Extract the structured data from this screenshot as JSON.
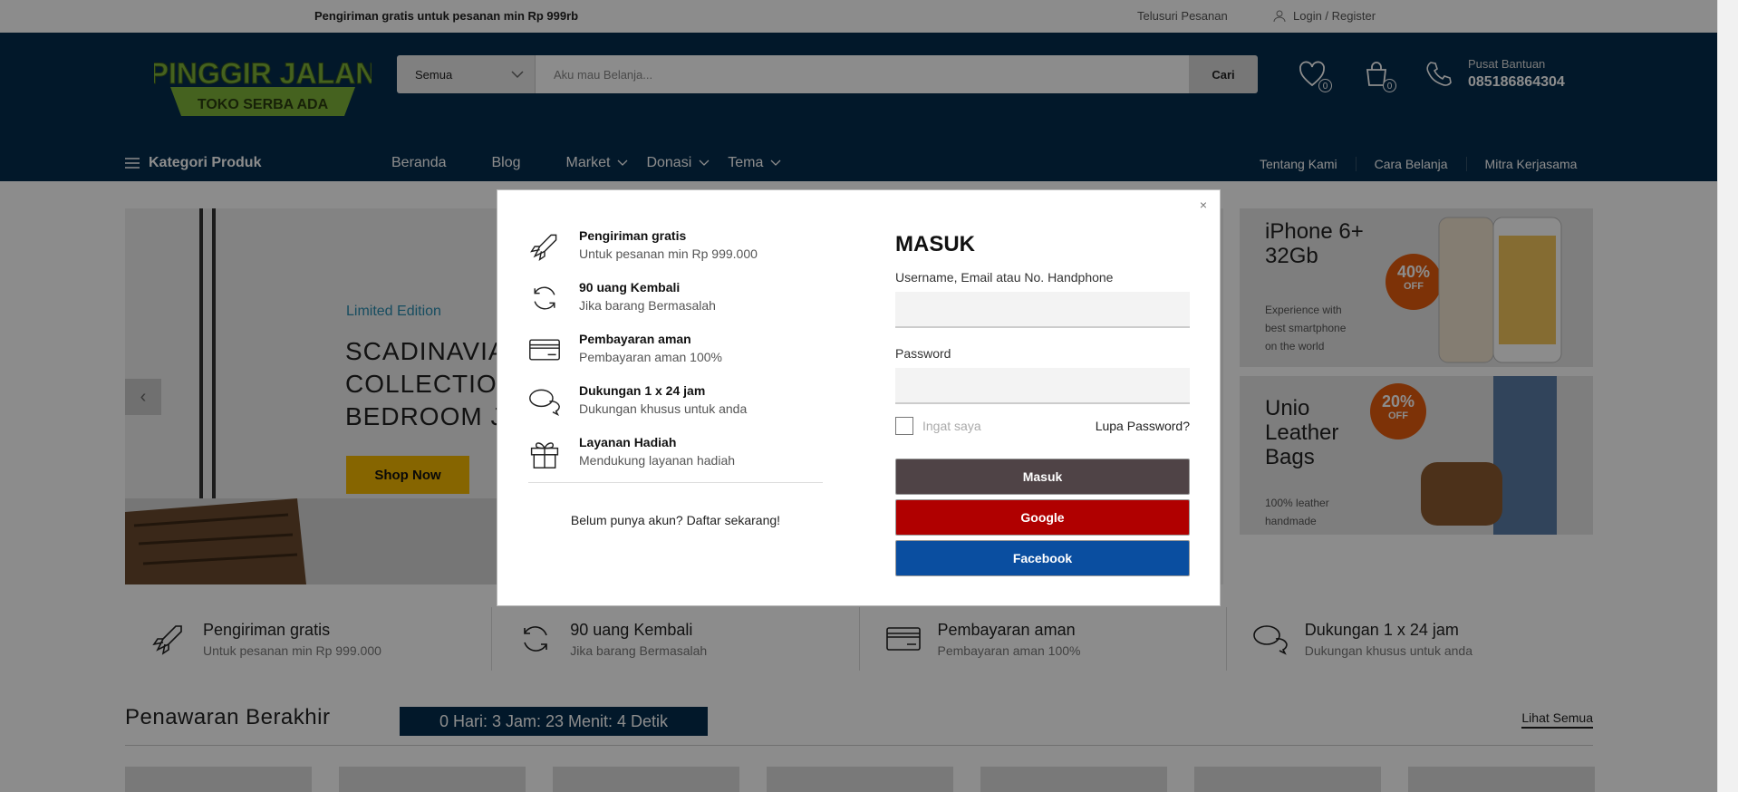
{
  "topbar": {
    "shipping": "Pengiriman gratis untuk pesanan min Rp 999rb",
    "track": "Telusuri Pesanan",
    "login": "Login / Register"
  },
  "header": {
    "logo_line1": "PINGGIR JALAN",
    "logo_line2": "TOKO SERBA ADA",
    "search": {
      "category": "Semua",
      "placeholder": "Aku mau Belanja...",
      "button": "Cari"
    },
    "wishlist_count": "0",
    "cart_count": "0",
    "help_label": "Pusat Bantuan",
    "help_phone": "085186864304"
  },
  "nav": {
    "category_label": "Kategori Produk",
    "items": [
      "Beranda",
      "Blog",
      "Market",
      "Donasi",
      "Tema"
    ],
    "right": [
      "Tentang Kami",
      "Cara Belanja",
      "Mitra Kerjasama"
    ]
  },
  "slider": {
    "tag": "Limited Edition",
    "title": "SCADINAVIA\nCOLLECTION\nBEDROOM J",
    "button": "Shop Now"
  },
  "promos": [
    {
      "title": "iPhone 6+\n32Gb",
      "text": "Experience with\nbest smartphone\non the world",
      "pct": "40%",
      "off": "OFF"
    },
    {
      "title": "Unio\nLeather\nBags",
      "text": "100% leather\nhandmade",
      "pct": "20%",
      "off": "OFF"
    }
  ],
  "features": [
    {
      "title": "Pengiriman gratis",
      "sub": "Untuk pesanan min Rp 999.000"
    },
    {
      "title": "90 uang Kembali",
      "sub": "Jika barang Bermasalah"
    },
    {
      "title": "Pembayaran aman",
      "sub": "Pembayaran aman 100%"
    },
    {
      "title": "Dukungan 1 x 24 jam",
      "sub": "Dukungan khusus untuk anda"
    }
  ],
  "deals": {
    "title": "Penawaran Berakhir",
    "countdown": "0 Hari: 3 Jam: 23 Menit: 4 Detik",
    "see_all": "Lihat Semua"
  },
  "modal": {
    "close": "×",
    "benefits": [
      {
        "title": "Pengiriman gratis",
        "sub": "Untuk pesanan min Rp 999.000"
      },
      {
        "title": "90 uang Kembali",
        "sub": "Jika barang Bermasalah"
      },
      {
        "title": "Pembayaran aman",
        "sub": "Pembayaran aman 100%"
      },
      {
        "title": "Dukungan 1 x 24 jam",
        "sub": "Dukungan khusus untuk anda"
      },
      {
        "title": "Layanan Hadiah",
        "sub": "Mendukung layanan hadiah"
      }
    ],
    "register": "Belum punya akun? Daftar sekarang!",
    "heading": "MASUK",
    "username_label": "Username, Email atau No. Handphone",
    "password_label": "Password",
    "remember": "Ingat saya",
    "forgot": "Lupa Password?",
    "login_button": "Masuk",
    "google_button": "Google",
    "facebook_button": "Facebook"
  },
  "colors": {
    "header_bg": "#052c4d",
    "shop_now": "#f5b800",
    "masuk": "#4f4346",
    "google": "#b00000",
    "facebook": "#0a4ea0"
  }
}
